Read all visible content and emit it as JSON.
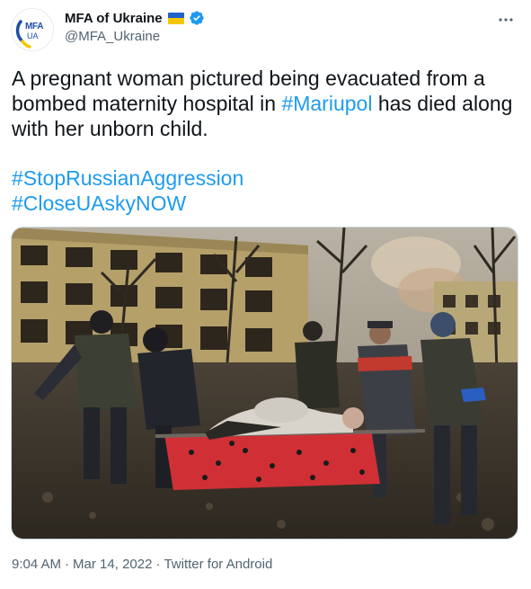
{
  "account": {
    "display_name": "MFA of Ukraine",
    "handle": "@MFA_Ukraine",
    "avatar_text": "MFA",
    "avatar_subtext": "UA",
    "flag_colors": [
      "#1f63c9",
      "#f6c700"
    ],
    "verified_color": "#1d9bf0",
    "verified_icon": "verified-badge-icon"
  },
  "tweet": {
    "text_part1": "A pregnant woman pictured being evacuated from a bombed maternity hospital in ",
    "link_text": "#Mariupol",
    "text_part2": " has died along with her unborn child.",
    "hashtags": [
      "#StopRussianAggression",
      "#CloseUAskyNOW"
    ],
    "link_color": "#1d9bf0"
  },
  "footer": {
    "time": "9:04 AM",
    "date": "Mar 14, 2022",
    "source": "Twitter for Android",
    "separator": "·"
  },
  "icons": {
    "more": "more-options-icon"
  }
}
